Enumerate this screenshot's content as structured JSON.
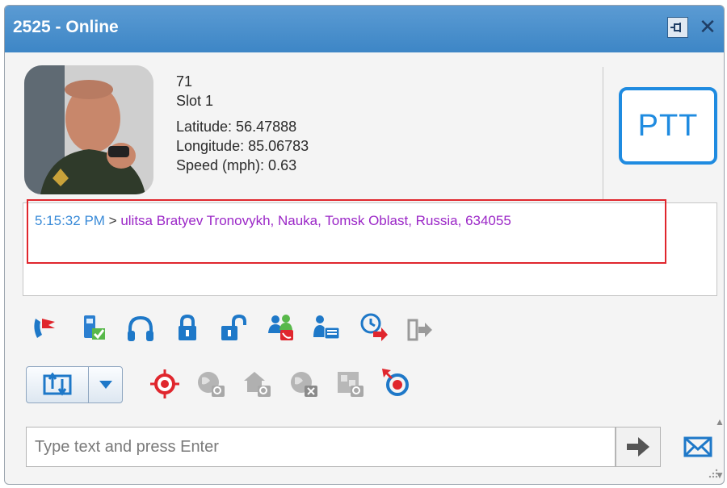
{
  "window": {
    "title": "2525 - Online"
  },
  "subscriber": {
    "id": "71",
    "slot": "Slot 1",
    "latitude": "Latitude: 56.47888",
    "longitude": "Longitude: 85.06783",
    "speed": "Speed (mph): 0.63"
  },
  "ptt": {
    "label": "PTT"
  },
  "log": {
    "entries": [
      {
        "time": "5:15:32 PM",
        "separator": " > ",
        "text": "ulitsa Bratyev Tronovykh, Nauka, Tomsk Oblast, Russia, 634055"
      }
    ]
  },
  "message": {
    "placeholder": "Type text and press Enter"
  },
  "colors": {
    "title_bar": "#4a90d2",
    "accent": "#1f8be0",
    "highlight": "#e0262d",
    "log_time": "#3a8bd8",
    "log_text": "#9b27c7"
  },
  "icons": {
    "row1": [
      "location-flag-icon",
      "radio-check-icon",
      "headset-icon",
      "lock-icon",
      "unlock-icon",
      "group-call-icon",
      "user-card-icon",
      "scheduled-send-icon",
      "exit-icon"
    ],
    "row2": [
      "location-dropdown-icon",
      "target-icon",
      "map-zoom-icon",
      "home-zoom-icon",
      "map-close-icon",
      "map-area-zoom-icon",
      "track-icon"
    ]
  }
}
